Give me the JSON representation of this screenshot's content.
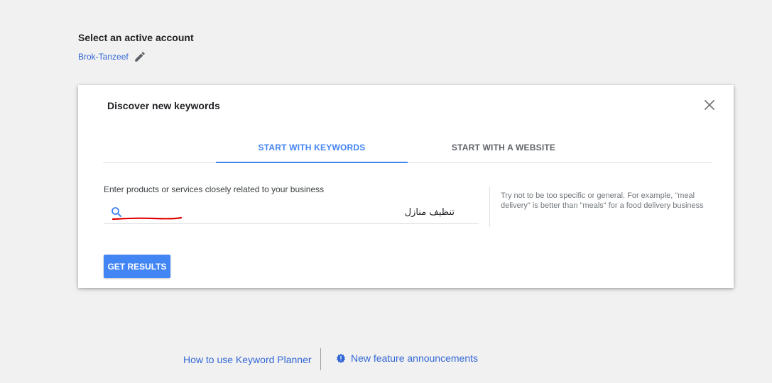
{
  "account": {
    "heading": "Select an active account",
    "name": "Brok-Tanzeef",
    "edit_icon": "pencil-icon"
  },
  "card": {
    "title": "Discover new keywords",
    "close_icon": "close-icon",
    "tabs": [
      {
        "label": "START WITH KEYWORDS",
        "active": true
      },
      {
        "label": "START WITH A WEBSITE",
        "active": false
      }
    ],
    "field_label": "Enter products or services closely related to your business",
    "search_icon": "search-icon",
    "input_value": "تنظيف منازل",
    "hint": "Try not to be too specific or general. For example, \"meal delivery\" is better than \"meals\" for a food delivery business",
    "button_label": "GET RESULTS"
  },
  "footer": {
    "howto_label": "How to use Keyword Planner",
    "announcements_label": "New feature announcements",
    "announcements_icon": "badge-icon"
  },
  "colors": {
    "accent": "#4285f4",
    "link": "#3367d6",
    "background": "#f1f1f1",
    "annotation_red": "#e00000"
  }
}
